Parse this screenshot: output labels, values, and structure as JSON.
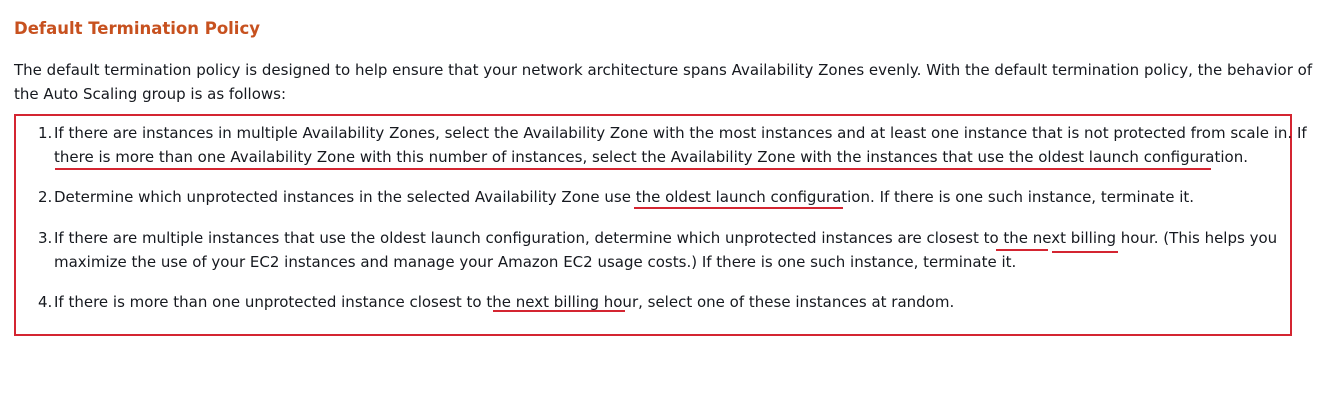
{
  "heading": "Default Termination Policy",
  "intro": "The default termination policy is designed to help ensure that your network architecture spans Availability Zones evenly. With the default termination policy, the behavior of the Auto Scaling group is as follows:",
  "steps": [
    {
      "number": "1.",
      "line1": "If there are instances in multiple Availability Zones, select the Availability Zone with the most instances and at least one instance that is not protected from scale in. If",
      "line2": "there is more than one Availability Zone with this number of instances, select the Availability Zone with the instances that use the oldest launch configuration."
    },
    {
      "number": "2.",
      "line1": "Determine which unprotected instances in the selected Availability Zone use the oldest launch configuration. If there is one such instance, terminate it."
    },
    {
      "number": "3.",
      "line1": "If there are multiple instances that use the oldest launch configuration, determine which unprotected instances are closest to the next billing hour. (This helps you",
      "line2": "maximize the use of your EC2 instances and manage your Amazon EC2 usage costs.) If there is one such instance, terminate it."
    },
    {
      "number": "4.",
      "line1": "If there is more than one unprotected instance closest to the next billing hour, select one of these instances at random."
    }
  ],
  "annotation_color": "#d42531",
  "heading_color": "#c7511f"
}
